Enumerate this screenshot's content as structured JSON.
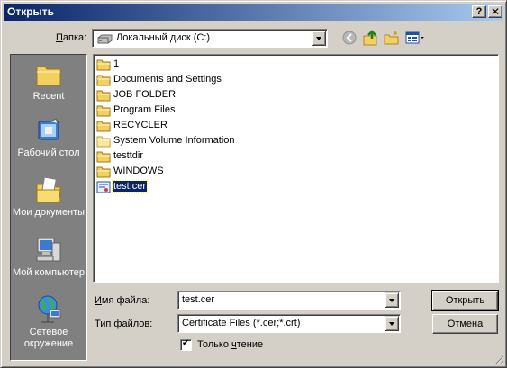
{
  "window": {
    "title": "Открыть",
    "help_glyph": "?",
    "close_glyph": "✕"
  },
  "folder_bar": {
    "label_accel": "П",
    "label_rest": "апка:",
    "current": "Локальный диск (C:)",
    "icons": [
      "drive-icon",
      "back-icon",
      "up-folder-icon",
      "new-folder-icon",
      "view-menu-icon"
    ]
  },
  "places": [
    {
      "label": "Recent",
      "icon": "recent-icon"
    },
    {
      "label": "Рабочий стол",
      "icon": "desktop-icon"
    },
    {
      "label": "Мои документы",
      "icon": "my-documents-icon"
    },
    {
      "label": "Мой компьютер",
      "icon": "my-computer-icon"
    },
    {
      "label": "Сетевое окружение",
      "icon": "network-icon"
    }
  ],
  "files": [
    {
      "name": "1",
      "type": "folder"
    },
    {
      "name": "Documents and Settings",
      "type": "folder"
    },
    {
      "name": "JOB FOLDER",
      "type": "folder"
    },
    {
      "name": "Program Files",
      "type": "folder"
    },
    {
      "name": "RECYCLER",
      "type": "folder"
    },
    {
      "name": "System Volume Information",
      "type": "folder"
    },
    {
      "name": "testtdir",
      "type": "folder"
    },
    {
      "name": "WINDOWS",
      "type": "folder"
    },
    {
      "name": "test.cer",
      "type": "certificate",
      "selected": true
    }
  ],
  "filename": {
    "label_accel": "И",
    "label_rest": "мя файла:",
    "value": "test.cer"
  },
  "filetype": {
    "label_accel": "Т",
    "label_rest": "ип файлов:",
    "value": "Certificate Files (*.cer;*.crt)"
  },
  "readonly": {
    "label_pre": "Только ",
    "label_accel": "ч",
    "label_rest": "тение",
    "checked": true
  },
  "buttons": {
    "open": "Открыть",
    "cancel": "Отмена"
  }
}
